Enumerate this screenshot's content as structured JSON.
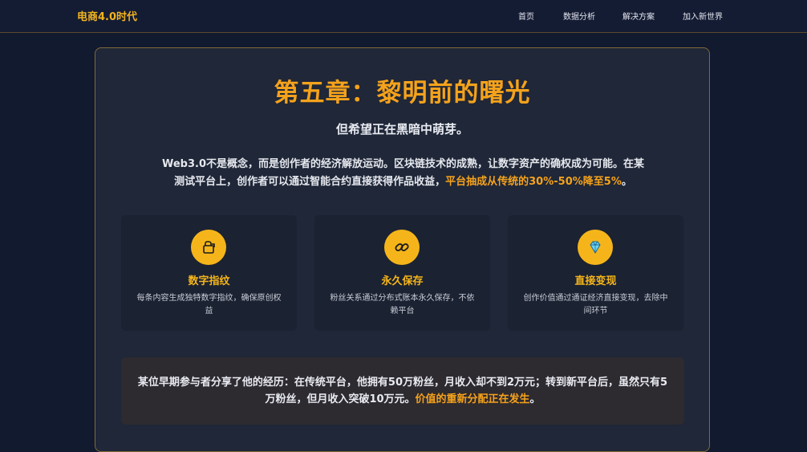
{
  "navbar": {
    "brand": "电商4.0时代",
    "links": [
      "首页",
      "数据分析",
      "解决方案",
      "加入新世界"
    ]
  },
  "chapter": {
    "title": "第五章：黎明前的曙光",
    "subtitle": "但希望正在黑暗中萌芽。",
    "intro_plain": "Web3.0不是概念，而是创作者的经济解放运动。区块链技术的成熟，让数字资产的确权成为可能。在某测试平台上，创作者可以通过智能合约直接获得作品收益，",
    "intro_highlight": "平台抽成从传统的30%-50%降至5%",
    "intro_end": "。"
  },
  "features": [
    {
      "icon": "fingerprint-icon",
      "title": "数字指纹",
      "desc": "每条内容生成独特数字指纹，确保原创权益"
    },
    {
      "icon": "link-chain-icon",
      "title": "永久保存",
      "desc": "粉丝关系通过分布式账本永久保存，不依赖平台"
    },
    {
      "icon": "diamond-icon",
      "title": "直接变现",
      "desc": "创作价值通过通证经济直接变现，去除中间环节"
    }
  ],
  "story": {
    "plain": "某位早期参与者分享了他的经历：在传统平台，他拥有50万粉丝，月收入却不到2万元；转到新平台后，虽然只有5万粉丝，但月收入突破10万元。",
    "highlight": "价值的重新分配正在发生",
    "end": "。"
  },
  "colors": {
    "accent": "#f5a21b",
    "icon_bg": "#f5b51a",
    "background": "#121a30",
    "panel": "#1f2738"
  }
}
